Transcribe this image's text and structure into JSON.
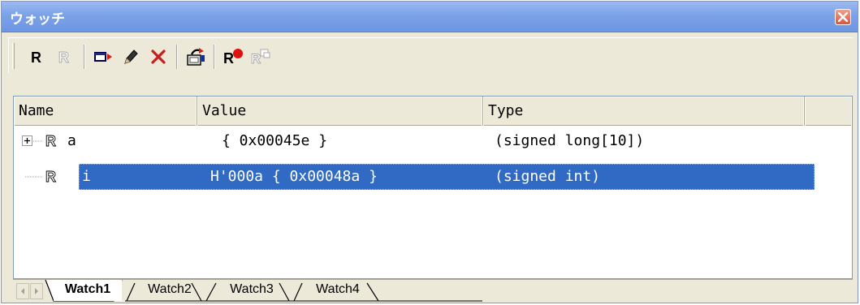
{
  "window": {
    "title": "ウォッチ"
  },
  "toolbar": {
    "buttons": [
      {
        "icon": "register-r-icon",
        "enabled": true
      },
      {
        "icon": "register-r-disabled-icon",
        "enabled": false
      },
      {
        "icon": "add-watch-icon",
        "enabled": true
      },
      {
        "icon": "edit-pencil-icon",
        "enabled": true
      },
      {
        "icon": "delete-x-icon",
        "enabled": true
      },
      {
        "icon": "radix-refresh-icon",
        "enabled": true
      },
      {
        "icon": "register-record-icon",
        "enabled": true
      },
      {
        "icon": "register-record-disabled-icon",
        "enabled": false
      }
    ]
  },
  "list": {
    "columns": [
      "Name",
      "Value",
      "Type"
    ],
    "rows": [
      {
        "expander": "+",
        "name": "a",
        "value": "{ 0x00045e }",
        "type": "(signed long[10])",
        "selected": false
      },
      {
        "expander": "",
        "name": "i",
        "value": "H'000a { 0x00048a }",
        "type": "(signed int)",
        "selected": true
      }
    ]
  },
  "tabs": {
    "items": [
      "Watch1",
      "Watch2",
      "Watch3",
      "Watch4"
    ],
    "active": "Watch1"
  },
  "colors": {
    "title_bar": "#7ba2e7",
    "selection": "#316ac5",
    "face": "#ece9d8",
    "close_button": "#d8573f"
  }
}
